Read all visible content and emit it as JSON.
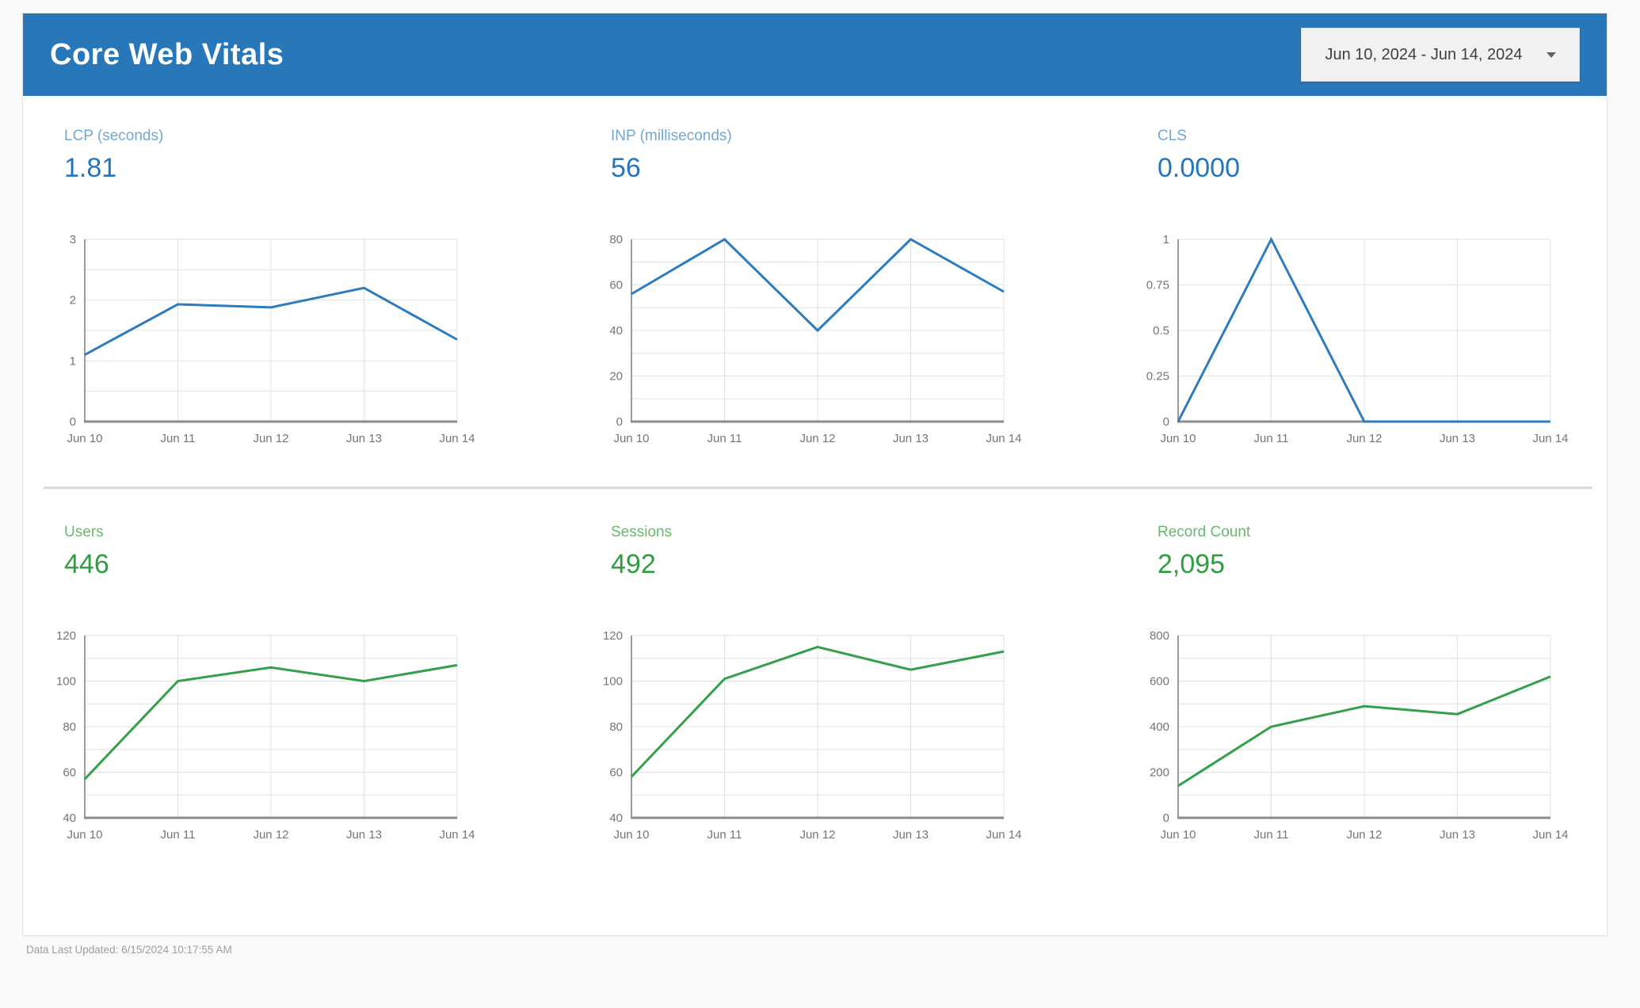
{
  "header": {
    "title": "Core Web Vitals",
    "date_range": "Jun 10, 2024 - Jun 14, 2024"
  },
  "footer": {
    "last_updated": "Data Last Updated: 6/15/2024 10:17:55 AM"
  },
  "colors": {
    "header_bg": "#2878b9",
    "blue_label": "#72a7d3",
    "blue_value": "#2577bd",
    "blue_line": "#2c7cbe",
    "green_label": "#68b96c",
    "green_value": "#2f9e41",
    "green_line": "#34a04b",
    "grid": "#e2e2e2",
    "axis": "#9b9b9b",
    "tick_text": "#757575"
  },
  "chart_data": [
    {
      "type": "line",
      "title": "LCP (seconds)",
      "metric_value": "1.81",
      "series_color": "blue_line",
      "label_color": "blue_label",
      "value_color": "blue_value",
      "categories": [
        "Jun 10",
        "Jun 11",
        "Jun 12",
        "Jun 13",
        "Jun 14"
      ],
      "values": [
        1.1,
        1.93,
        1.88,
        2.2,
        1.35
      ],
      "ylim": [
        0,
        3
      ],
      "yticks": [
        0,
        1,
        2,
        3
      ],
      "ygrid_step": 0.5,
      "xlabel": "",
      "ylabel": "",
      "grid": true,
      "legend": false
    },
    {
      "type": "line",
      "title": "INP (milliseconds)",
      "metric_value": "56",
      "series_color": "blue_line",
      "label_color": "blue_label",
      "value_color": "blue_value",
      "categories": [
        "Jun 10",
        "Jun 11",
        "Jun 12",
        "Jun 13",
        "Jun 14"
      ],
      "values": [
        56,
        80,
        40,
        80,
        57
      ],
      "ylim": [
        0,
        80
      ],
      "yticks": [
        0,
        20,
        40,
        60,
        80
      ],
      "ygrid_step": 10,
      "xlabel": "",
      "ylabel": "",
      "grid": true,
      "legend": false
    },
    {
      "type": "line",
      "title": "CLS",
      "metric_value": "0.0000",
      "series_color": "blue_line",
      "label_color": "blue_label",
      "value_color": "blue_value",
      "categories": [
        "Jun 10",
        "Jun 11",
        "Jun 12",
        "Jun 13",
        "Jun 14"
      ],
      "values": [
        0,
        1,
        0,
        0,
        0
      ],
      "ylim": [
        0,
        1
      ],
      "yticks": [
        0,
        0.25,
        0.5,
        0.75,
        1
      ],
      "ygrid_step": 0.25,
      "xlabel": "",
      "ylabel": "",
      "grid": true,
      "legend": false
    },
    {
      "type": "line",
      "title": "Users",
      "metric_value": "446",
      "series_color": "green_line",
      "label_color": "green_label",
      "value_color": "green_value",
      "categories": [
        "Jun 10",
        "Jun 11",
        "Jun 12",
        "Jun 13",
        "Jun 14"
      ],
      "values": [
        57,
        100,
        106,
        100,
        107
      ],
      "ylim": [
        40,
        120
      ],
      "yticks": [
        40,
        60,
        80,
        100,
        120
      ],
      "ygrid_step": 10,
      "xlabel": "",
      "ylabel": "",
      "grid": true,
      "legend": false
    },
    {
      "type": "line",
      "title": "Sessions",
      "metric_value": "492",
      "series_color": "green_line",
      "label_color": "green_label",
      "value_color": "green_value",
      "categories": [
        "Jun 10",
        "Jun 11",
        "Jun 12",
        "Jun 13",
        "Jun 14"
      ],
      "values": [
        58,
        101,
        115,
        105,
        113
      ],
      "ylim": [
        40,
        120
      ],
      "yticks": [
        40,
        60,
        80,
        100,
        120
      ],
      "ygrid_step": 10,
      "xlabel": "",
      "ylabel": "",
      "grid": true,
      "legend": false
    },
    {
      "type": "line",
      "title": "Record Count",
      "metric_value": "2,095",
      "series_color": "green_line",
      "label_color": "green_label",
      "value_color": "green_value",
      "categories": [
        "Jun 10",
        "Jun 11",
        "Jun 12",
        "Jun 13",
        "Jun 14"
      ],
      "values": [
        140,
        400,
        490,
        455,
        620
      ],
      "ylim": [
        0,
        800
      ],
      "yticks": [
        0,
        200,
        400,
        600,
        800
      ],
      "ygrid_step": 100,
      "xlabel": "",
      "ylabel": "",
      "grid": true,
      "legend": false
    }
  ]
}
